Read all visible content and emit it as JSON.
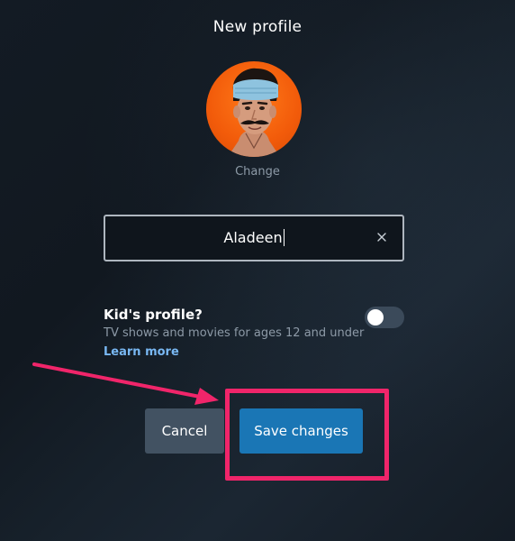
{
  "dialog": {
    "title": "New profile",
    "avatar_alt": "profile-avatar",
    "change_label": "Change",
    "name_field": {
      "value": "Aladeen",
      "placeholder": ""
    },
    "clear_icon": "close-icon"
  },
  "kids_profile": {
    "title": "Kid's profile?",
    "description": "TV shows and movies for ages 12 and under",
    "learn_more": "Learn more",
    "enabled": false
  },
  "actions": {
    "cancel_label": "Cancel",
    "save_label": "Save changes"
  },
  "colors": {
    "background": "#131b24",
    "accent": "#1a76b5",
    "link": "#79b8f3",
    "annotation": "#f0256a",
    "avatar_orange": "#f25b0a"
  },
  "annotations": {
    "arrow_icon": "arrow-right-icon",
    "highlight": "highlight-box"
  }
}
